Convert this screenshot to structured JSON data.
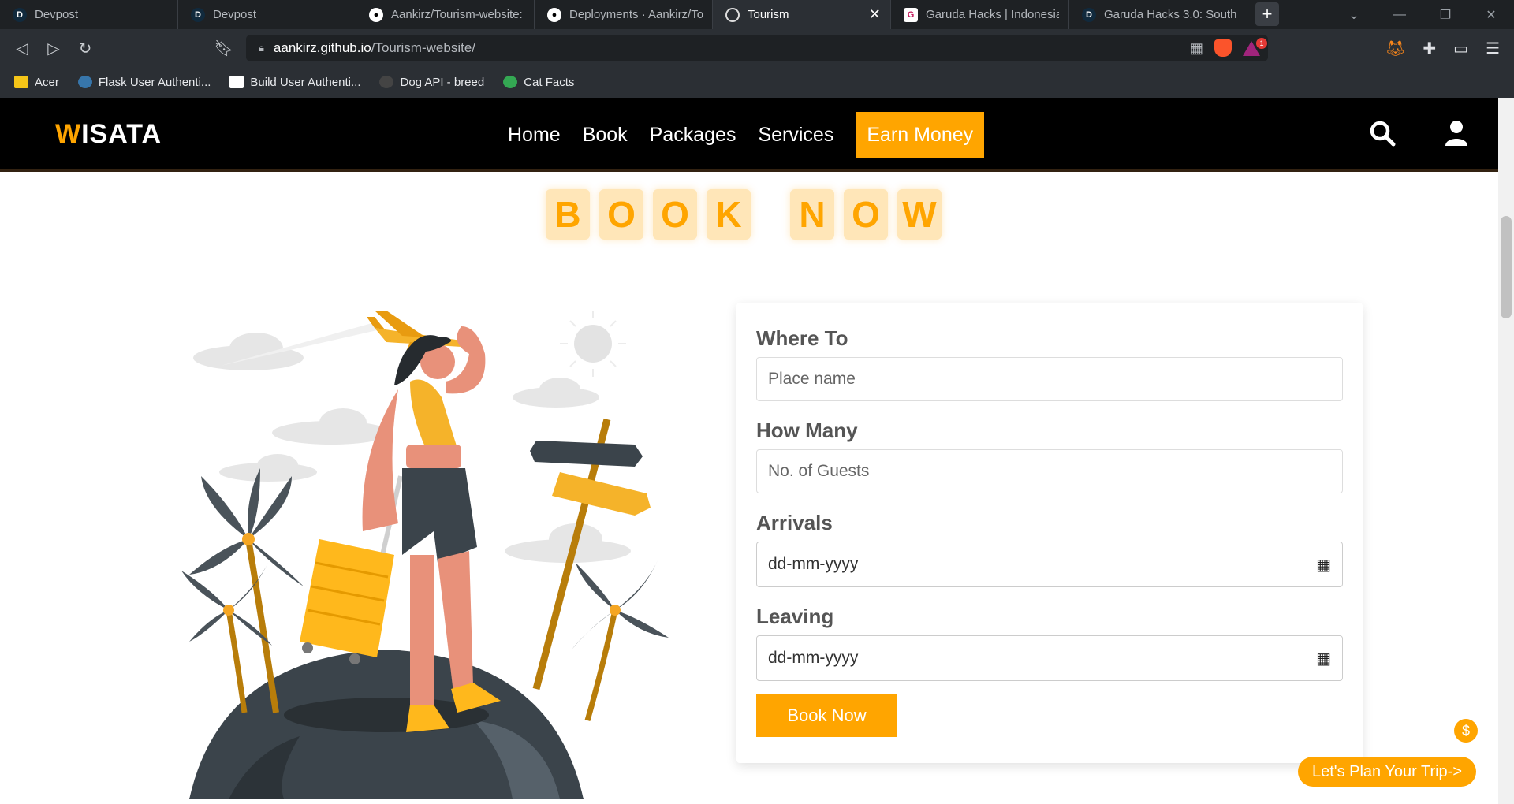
{
  "browser": {
    "tabs": [
      {
        "label": "Devpost",
        "favicon": "devpost-icon",
        "active": false
      },
      {
        "label": "Devpost",
        "favicon": "devpost-icon",
        "active": false
      },
      {
        "label": "Aankirz/Tourism-website: a",
        "favicon": "github-icon",
        "active": false
      },
      {
        "label": "Deployments · Aankirz/Tou",
        "favicon": "github-icon",
        "active": false
      },
      {
        "label": "Tourism",
        "favicon": "globe-icon",
        "active": true
      },
      {
        "label": "Garuda Hacks | Indonesia's",
        "favicon": "garuda-icon",
        "active": false
      },
      {
        "label": "Garuda Hacks 3.0: Southea",
        "favicon": "devpost-icon",
        "active": false
      }
    ],
    "url_host": "aankirz.github.io",
    "url_path": "/Tourism-website/",
    "notification_count": "1",
    "bookmarks": [
      {
        "label": "Acer",
        "icon": "folder-icon",
        "color": "#f5c518"
      },
      {
        "label": "Flask User Authenti...",
        "icon": "python-icon",
        "color": "#3776ab"
      },
      {
        "label": "Build User Authenti...",
        "icon": "doc-icon",
        "color": "#ffffff"
      },
      {
        "label": "Dog API - breed",
        "icon": "dog-icon",
        "color": "#444444"
      },
      {
        "label": "Cat Facts",
        "icon": "globe-green-icon",
        "color": "#34a853"
      }
    ]
  },
  "site": {
    "logo_first": "W",
    "logo_rest": "ISATA",
    "nav": [
      {
        "label": "Home"
      },
      {
        "label": "Book"
      },
      {
        "label": "Packages"
      },
      {
        "label": "Services"
      },
      {
        "label": "Earn Money",
        "highlight": true
      }
    ],
    "heading_word1": [
      "B",
      "O",
      "O",
      "K"
    ],
    "heading_word2": [
      "N",
      "O",
      "W"
    ],
    "form": {
      "where_label": "Where To",
      "where_placeholder": "Place name",
      "howmany_label": "How Many",
      "howmany_placeholder": "No. of Guests",
      "arrivals_label": "Arrivals",
      "arrivals_value": "dd-mm-yyyy",
      "leaving_label": "Leaving",
      "leaving_value": "dd-mm-yyyy",
      "submit_label": "Book Now"
    },
    "coin_symbol": "$",
    "plan_trip_label": "Let's Plan Your Trip->",
    "colors": {
      "accent": "#ffa500",
      "header_bg": "#000000",
      "letter_bg": "#ffe6b8"
    }
  }
}
